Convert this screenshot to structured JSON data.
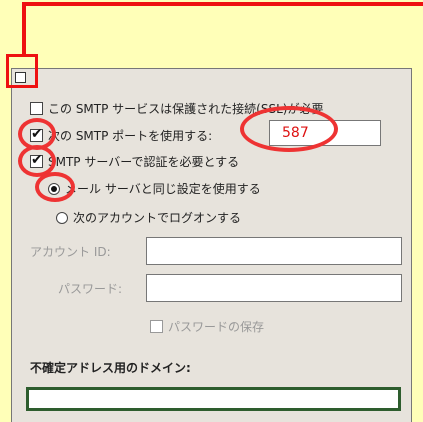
{
  "dialog": {
    "ssl_checkbox": {
      "label": "この SMTP サービスは保護された接続(SSL)が必要",
      "checked": false
    },
    "port_checkbox": {
      "label": "次の SMTP ポートを使用する:",
      "checked": true
    },
    "port_input": {
      "value": "587"
    },
    "auth_checkbox": {
      "label": "SMTP サーバーで認証を必要とする",
      "checked": true
    },
    "radio_same_settings": {
      "label": "メール サーバと同じ設定を使用する",
      "selected": true
    },
    "radio_logon_account": {
      "label": "次のアカウントでログオンする",
      "selected": false
    },
    "account_id": {
      "label": "アカウント ID:",
      "value": ""
    },
    "password": {
      "label": "パスワード:",
      "value": ""
    },
    "save_password": {
      "label": "パスワードの保存",
      "checked": false
    },
    "domain": {
      "label": "不確定アドレス用のドメイン:",
      "value": ""
    }
  },
  "colors": {
    "background": "#ffffb8",
    "annotation": "#e11",
    "dialog_bg": "#e7e3dc",
    "domain_border": "#2e5d2e"
  }
}
